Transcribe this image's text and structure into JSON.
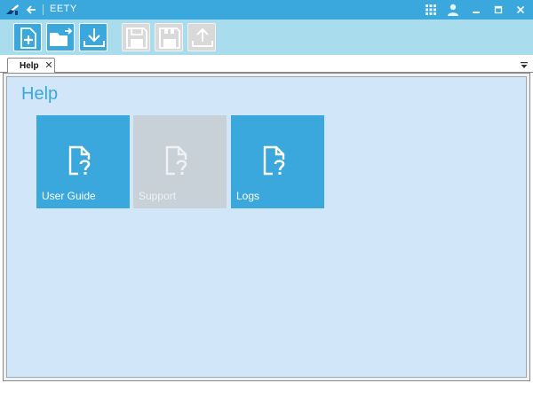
{
  "window": {
    "title": "EETY",
    "accent": "#3aa8dc",
    "icons": [
      "app-logo-icon",
      "back-arrow-icon",
      "grid-icon",
      "user-icon",
      "minimize-icon",
      "maximize-icon",
      "close-icon"
    ]
  },
  "toolbar": {
    "buttons": [
      {
        "name": "new-document",
        "icon": "new-document-icon",
        "enabled": true
      },
      {
        "name": "open-folder",
        "icon": "open-folder-icon",
        "enabled": true
      },
      {
        "name": "download",
        "icon": "download-icon",
        "enabled": true
      },
      {
        "name": "save",
        "icon": "save-icon",
        "enabled": false
      },
      {
        "name": "save-all",
        "icon": "save-all-icon",
        "enabled": false
      },
      {
        "name": "upload",
        "icon": "upload-icon",
        "enabled": false
      }
    ]
  },
  "tabs": [
    {
      "label": "Help",
      "close": "✕",
      "active": true
    }
  ],
  "help": {
    "title": "Help",
    "tiles": [
      {
        "label": "User Guide",
        "icon": "document-question-icon",
        "enabled": true
      },
      {
        "label": "Support",
        "icon": "document-question-icon",
        "enabled": false
      },
      {
        "label": "Logs",
        "icon": "document-question-icon",
        "enabled": true
      }
    ]
  }
}
